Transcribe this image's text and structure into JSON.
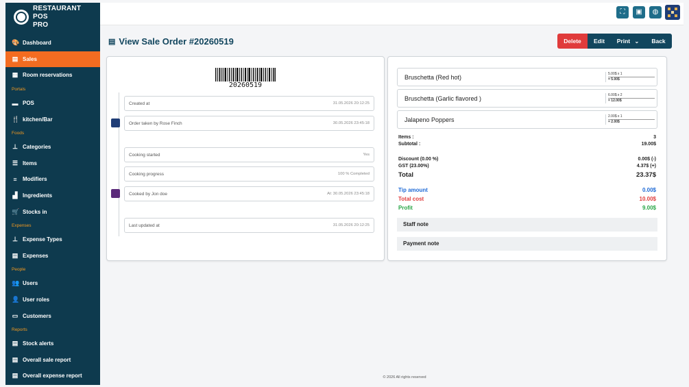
{
  "app": {
    "title_line1": "RESTAURANT POS",
    "title_line2": "PRO"
  },
  "sidebar": {
    "items": [
      {
        "type": "item",
        "label": "Dashboard",
        "icon": "palette-icon",
        "glyph": "🎨",
        "active": false
      },
      {
        "type": "item",
        "label": "Sales",
        "icon": "sales-doc-icon",
        "glyph": "▤",
        "active": true
      },
      {
        "type": "item",
        "label": "Room reservations",
        "icon": "calendar-icon",
        "glyph": "▦",
        "active": false
      },
      {
        "type": "section",
        "label": "Portals"
      },
      {
        "type": "item",
        "label": "POS",
        "icon": "pos-icon",
        "glyph": "▬",
        "active": false
      },
      {
        "type": "item",
        "label": "kitchen/Bar",
        "icon": "utensils-icon",
        "glyph": "🍴",
        "active": false
      },
      {
        "type": "section",
        "label": "Foods"
      },
      {
        "type": "item",
        "label": "Categories",
        "icon": "sitemap-icon",
        "glyph": "⊥",
        "active": false
      },
      {
        "type": "item",
        "label": "Items",
        "icon": "list-icon",
        "glyph": "☰",
        "active": false
      },
      {
        "type": "item",
        "label": "Modifiers",
        "icon": "bars-icon",
        "glyph": "≡",
        "active": false
      },
      {
        "type": "item",
        "label": "Ingredients",
        "icon": "cubes-icon",
        "glyph": "▟",
        "active": false
      },
      {
        "type": "item",
        "label": "Stocks in",
        "icon": "cart-icon",
        "glyph": "🛒",
        "active": false
      },
      {
        "type": "section",
        "label": "Expenses"
      },
      {
        "type": "item",
        "label": "Expense Types",
        "icon": "sitemap-icon",
        "glyph": "⊥",
        "active": false
      },
      {
        "type": "item",
        "label": "Expenses",
        "icon": "file-icon",
        "glyph": "▤",
        "active": false
      },
      {
        "type": "section",
        "label": "People"
      },
      {
        "type": "item",
        "label": "Users",
        "icon": "users-icon",
        "glyph": "👥",
        "active": false
      },
      {
        "type": "item",
        "label": "User roles",
        "icon": "user-shield-icon",
        "glyph": "👤",
        "active": false
      },
      {
        "type": "item",
        "label": "Customers",
        "icon": "store-icon",
        "glyph": "▭",
        "active": false
      },
      {
        "type": "section",
        "label": "Reports"
      },
      {
        "type": "item",
        "label": "Stock alerts",
        "icon": "file-icon",
        "glyph": "▤",
        "active": false
      },
      {
        "type": "item",
        "label": "Overall sale report",
        "icon": "file-icon",
        "glyph": "▤",
        "active": false
      },
      {
        "type": "item",
        "label": "Overall expense report",
        "icon": "file-icon",
        "glyph": "▤",
        "active": false
      }
    ]
  },
  "topbar": {
    "buttons": [
      {
        "icon": "fullscreen-icon",
        "glyph": "⛶"
      },
      {
        "icon": "cash-register-icon",
        "glyph": "▣"
      },
      {
        "icon": "globe-icon",
        "glyph": "◍"
      }
    ]
  },
  "page": {
    "title": "View Sale Order #20260519"
  },
  "actions": {
    "delete": "Delete",
    "edit": "Edit",
    "print": "Print",
    "print_caret": "⌄",
    "back": "Back"
  },
  "order": {
    "barcode_number": "20260519",
    "timeline": [
      {
        "label": "Created at",
        "value": "31.05.2026 20:12:25",
        "avatar": false
      },
      {
        "label": "Order taken by Rose Finch",
        "value": "30.05.2026 23:45:18",
        "avatar": true
      },
      {
        "label": "Cooking started",
        "value": "Yes",
        "avatar": false
      },
      {
        "label": "Cooking progress",
        "value": "100 % Completed",
        "avatar": false
      },
      {
        "label": "Cooked by Jon doe",
        "value": "At: 30.05.2026 23:45:18",
        "avatar": true
      },
      {
        "label": "Last updated at",
        "value": "31.05.2026 20:12:25",
        "avatar": false
      }
    ],
    "items": [
      {
        "name": "Bruschetta (Red hot)",
        "calc": "5.00$ x 1",
        "total": "= 5.00$"
      },
      {
        "name": "Bruschetta (Garlic flavored )",
        "calc": "6.00$ x 2",
        "total": "= 12.00$"
      },
      {
        "name": "Jalapeno Poppers",
        "calc": "2.00$ x 1",
        "total": "= 2.00$"
      }
    ],
    "summary": {
      "items_label": "Items :",
      "items_value": "3",
      "subtotal_label": "Subtotal :",
      "subtotal_value": "19.00$",
      "discount_label": "Discount (0.00 %)",
      "discount_value": "0.00$ (-)",
      "gst_label": "GST (23.00%)",
      "gst_value": "4.37$ (+)",
      "total_label": "Total",
      "total_value": "23.37$",
      "tip_label": "Tip amount",
      "tip_value": "0.00$",
      "cost_label": "Total cost",
      "cost_value": "10.00$",
      "profit_label": "Profit",
      "profit_value": "9.00$"
    },
    "notes": {
      "staff": "Staff note",
      "payment": "Payment note"
    }
  },
  "footer": {
    "text": "© 2026 All rights reserved"
  }
}
